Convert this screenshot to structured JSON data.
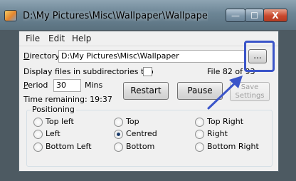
{
  "window": {
    "title": "D:\\My Pictures\\Misc\\Wallpaper\\Wallpaper (...",
    "minimize_glyph": "—",
    "maximize_glyph": "☐",
    "close_glyph": "X"
  },
  "menu": {
    "items": [
      "File",
      "Edit",
      "Help"
    ]
  },
  "directory": {
    "label_underlined": "D",
    "label_rest": "irectory",
    "value": "D:\\My Pictures\\Misc\\Wallpaper",
    "browse_label": "..."
  },
  "subdirs": {
    "label": "Display files in subdirectories too",
    "checked": false
  },
  "file_counter": "File 82 of 93",
  "period": {
    "label_underlined": "P",
    "label_rest": "eriod",
    "value": "30",
    "unit": "Mins"
  },
  "time_remaining": "Time remaining: 19:37",
  "buttons": {
    "restart": "Restart",
    "pause": "Pause",
    "save_settings_line1": "Save",
    "save_settings_line2": "Settings"
  },
  "positioning": {
    "title": "Positioning",
    "options": [
      {
        "label": "Top left",
        "checked": false
      },
      {
        "label": "Top",
        "checked": false
      },
      {
        "label": "Top Right",
        "checked": false
      },
      {
        "label": "Left",
        "checked": false
      },
      {
        "label": "Centred",
        "checked": true
      },
      {
        "label": "Right",
        "checked": false
      },
      {
        "label": "Bottom Left",
        "checked": false
      },
      {
        "label": "Bottom",
        "checked": false
      },
      {
        "label": "Bottom Right",
        "checked": false
      }
    ]
  },
  "annotation_color": "#3b55c9"
}
